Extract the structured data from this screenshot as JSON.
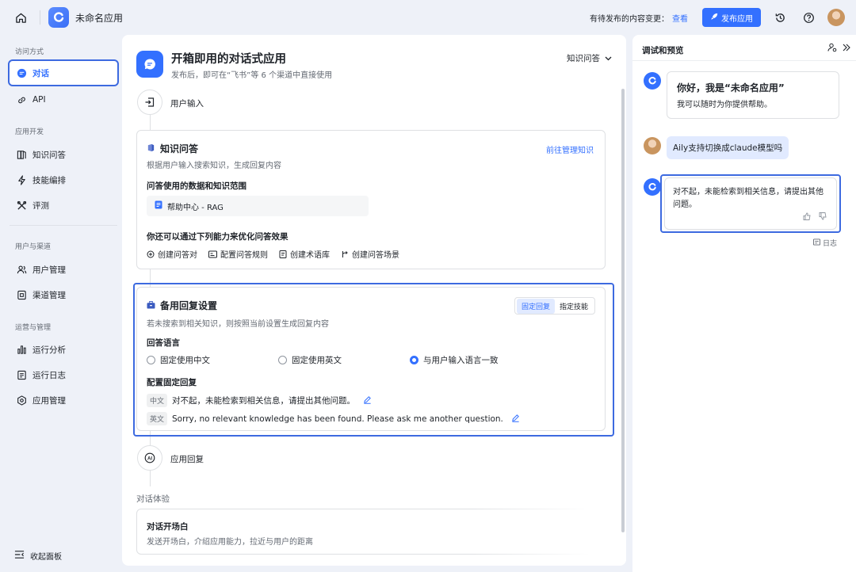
{
  "topbar": {
    "app_name": "未命名应用",
    "pending_text": "有待发布的内容变更：",
    "pending_link": "查看",
    "publish_label": "发布应用"
  },
  "sidebar": {
    "section_access": "访问方式",
    "item_chat": "对话",
    "item_api": "API",
    "section_dev": "应用开发",
    "item_qa": "知识问答",
    "item_skills": "技能编排",
    "item_eval": "评测",
    "section_users": "用户与渠道",
    "item_users": "用户管理",
    "item_channels": "渠道管理",
    "section_ops": "运营与管理",
    "item_analytics": "运行分析",
    "item_logs": "运行日志",
    "item_manage": "应用管理",
    "collapse_label": "收起面板"
  },
  "header": {
    "title": "开箱即用的对话式应用",
    "subtitle": "发布后，即可在“飞书”等 6 个渠道中直接使用",
    "mode": "知识问答"
  },
  "flow": {
    "user_input": "用户输入",
    "app_reply": "应用回复"
  },
  "qa_card": {
    "title": "知识问答",
    "manage_link": "前往管理知识",
    "desc": "根据用户输入搜索知识，生成回复内容",
    "scope_label": "问答使用的数据和知识范围",
    "kb_name": "帮助中心 - RAG",
    "optimize_label": "你还可以通过下列能力来优化问答效果",
    "opt1": "创建问答对",
    "opt2": "配置问答规则",
    "opt3": "创建术语库",
    "opt4": "创建问答场景"
  },
  "fallback_card": {
    "title": "备用回复设置",
    "seg_fixed": "固定回复",
    "seg_skill": "指定技能",
    "desc": "若未搜索到相关知识，则按照当前设置生成回复内容",
    "lang_label": "回答语言",
    "radio1": "固定使用中文",
    "radio2": "固定使用英文",
    "radio3": "与用户输入语言一致",
    "fixed_label": "配置固定回复",
    "zh_tag": "中文",
    "zh_reply": "对不起，未能检索到相关信息，请提出其他问题。",
    "en_tag": "英文",
    "en_reply": "Sorry, no relevant knowledge has been found. Please ask me another question."
  },
  "experience": {
    "section": "对话体验",
    "opening_title": "对话开场白",
    "opening_desc": "发送开场白，介绍应用能力，拉近与用户的距离"
  },
  "preview": {
    "title": "调试和预览",
    "greeting_title": "你好，我是“未命名应用”",
    "greeting_sub": "我可以随时为你提供帮助。",
    "user_msg": "Aily支持切换成claude模型吗",
    "bot_reply": "对不起，未能检索到相关信息，请提出其他问题。",
    "log_label": "日志"
  }
}
